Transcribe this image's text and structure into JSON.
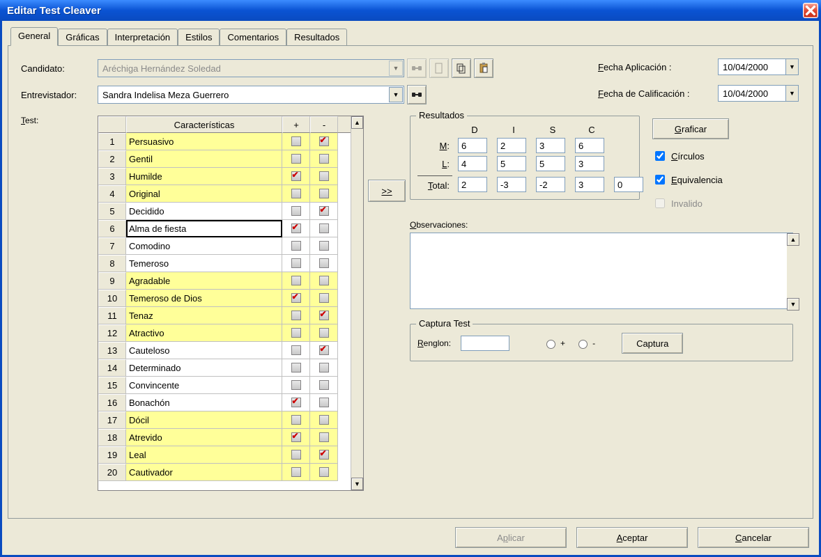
{
  "window": {
    "title": "Editar Test Cleaver"
  },
  "tabs": [
    "General",
    "Gráficas",
    "Interpretación",
    "Estilos",
    "Comentarios",
    "Resultados"
  ],
  "active_tab": 0,
  "labels": {
    "candidato": "Candidato:",
    "entrevistador": "Entrevistador:",
    "test": "Test:",
    "fecha_aplicacion": "Fecha Aplicación :",
    "fecha_calificacion": "Fecha de Calificación :",
    "observaciones": "Observaciones:",
    "resultados": "Resultados",
    "captura_test": "Captura Test",
    "renglon": "Renglon:",
    "graficar": "Graficar",
    "circulos": "Círculos",
    "equivalencia": "Equivalencia",
    "invalido": "Invalido",
    "captura": "Captura",
    "transfer": ">>",
    "aplicar": "Aplicar",
    "aceptar": "Aceptar",
    "cancelar": "Cancelar"
  },
  "values": {
    "candidato": "Aréchiga Hernández Soledad",
    "entrevistador": "Sandra Indelisa Meza Guerrero",
    "fecha_aplicacion": "10/04/2000",
    "fecha_calificacion": "10/04/2000",
    "observaciones": "",
    "renglon": "",
    "captura_sign": "",
    "circulos_checked": true,
    "equivalencia_checked": true,
    "invalido_checked": false
  },
  "grid": {
    "headers": {
      "c1": "Características",
      "c2": "+",
      "c3": "-"
    },
    "rows": [
      {
        "n": 1,
        "text": "Persuasivo",
        "plus": false,
        "minus": true,
        "yellow": true
      },
      {
        "n": 2,
        "text": "Gentil",
        "plus": false,
        "minus": false,
        "yellow": true
      },
      {
        "n": 3,
        "text": "Humilde",
        "plus": true,
        "minus": false,
        "yellow": true
      },
      {
        "n": 4,
        "text": "Original",
        "plus": false,
        "minus": false,
        "yellow": true
      },
      {
        "n": 5,
        "text": "Decidido",
        "plus": false,
        "minus": true,
        "yellow": false
      },
      {
        "n": 6,
        "text": "Alma de fiesta",
        "plus": true,
        "minus": false,
        "yellow": false,
        "selected": true
      },
      {
        "n": 7,
        "text": "Comodino",
        "plus": false,
        "minus": false,
        "yellow": false
      },
      {
        "n": 8,
        "text": "Temeroso",
        "plus": false,
        "minus": false,
        "yellow": false
      },
      {
        "n": 9,
        "text": "Agradable",
        "plus": false,
        "minus": false,
        "yellow": true
      },
      {
        "n": 10,
        "text": "Temeroso de Dios",
        "plus": true,
        "minus": false,
        "yellow": true
      },
      {
        "n": 11,
        "text": "Tenaz",
        "plus": false,
        "minus": true,
        "yellow": true
      },
      {
        "n": 12,
        "text": "Atractivo",
        "plus": false,
        "minus": false,
        "yellow": true
      },
      {
        "n": 13,
        "text": "Cauteloso",
        "plus": false,
        "minus": true,
        "yellow": false
      },
      {
        "n": 14,
        "text": "Determinado",
        "plus": false,
        "minus": false,
        "yellow": false
      },
      {
        "n": 15,
        "text": "Convincente",
        "plus": false,
        "minus": false,
        "yellow": false
      },
      {
        "n": 16,
        "text": "Bonachón",
        "plus": true,
        "minus": false,
        "yellow": false
      },
      {
        "n": 17,
        "text": "Dócil",
        "plus": false,
        "minus": false,
        "yellow": true
      },
      {
        "n": 18,
        "text": "Atrevido",
        "plus": true,
        "minus": false,
        "yellow": true
      },
      {
        "n": 19,
        "text": "Leal",
        "plus": false,
        "minus": true,
        "yellow": true
      },
      {
        "n": 20,
        "text": "Cautivador",
        "plus": false,
        "minus": false,
        "yellow": true
      }
    ]
  },
  "results": {
    "cols": [
      "D",
      "I",
      "S",
      "C"
    ],
    "rows": {
      "M": [
        6,
        2,
        3,
        6
      ],
      "L": [
        4,
        5,
        5,
        3
      ],
      "Total": [
        2,
        -3,
        -2,
        3
      ]
    },
    "total_extra": 0,
    "row_labels": {
      "M": "M:",
      "L": "L:",
      "Total": "Total:"
    }
  }
}
